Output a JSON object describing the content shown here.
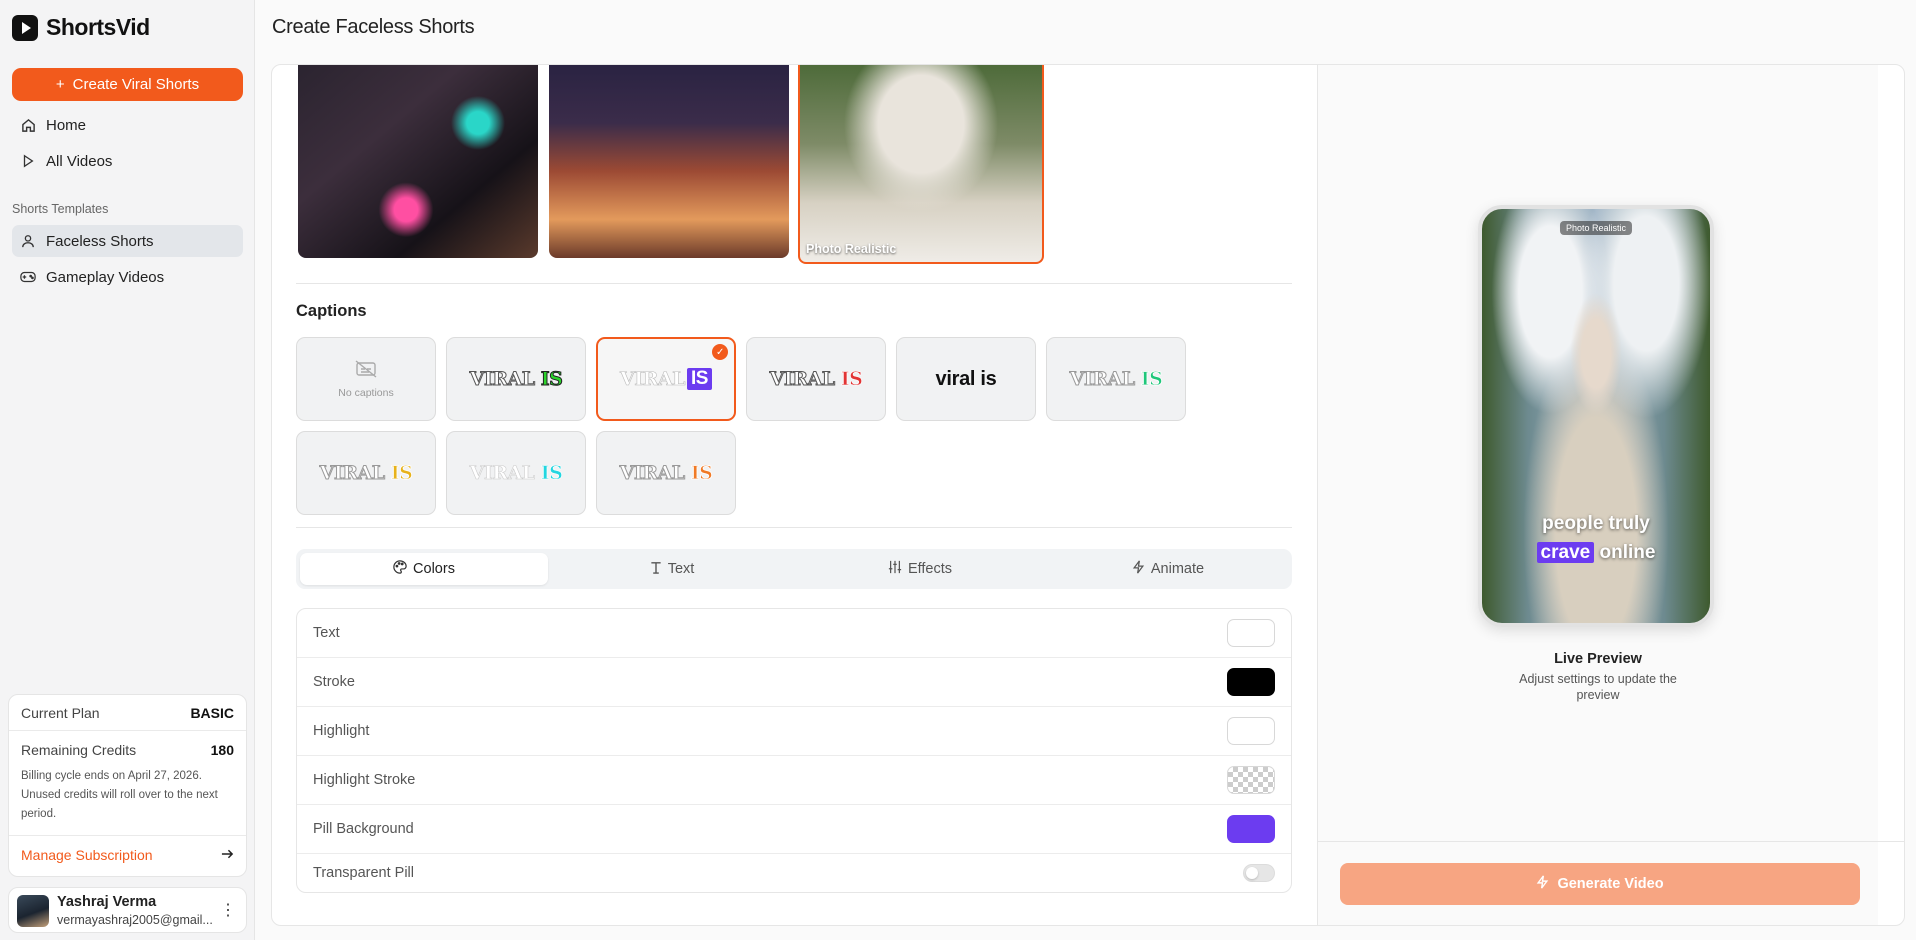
{
  "app": {
    "name": "ShortsVid"
  },
  "sidebar": {
    "create_label": "Create Viral Shorts",
    "nav": [
      {
        "label": "Home"
      },
      {
        "label": "All Videos"
      }
    ],
    "templates_label": "Shorts Templates",
    "templates": [
      {
        "label": "Faceless Shorts",
        "active": true
      },
      {
        "label": "Gameplay Videos",
        "active": false
      }
    ]
  },
  "plan": {
    "current_label": "Current Plan",
    "current_value": "BASIC",
    "credits_label": "Remaining Credits",
    "credits_value": "180",
    "billing_note": "Billing cycle ends on April 27, 2026. Unused credits will roll over to the next period.",
    "manage_label": "Manage Subscription"
  },
  "user": {
    "name": "Yashraj Verma",
    "email": "vermayashraj2005@gmail..."
  },
  "header": {
    "title": "Create Faceless Shorts"
  },
  "styles": {
    "selected_label": "Photo Realistic"
  },
  "captions": {
    "title": "Captions",
    "none_label": "No captions",
    "sample_word1": "VIRAL",
    "sample_word2": "IS",
    "sample_lower": "viral is"
  },
  "tabs": [
    {
      "label": "Colors",
      "icon": "palette-icon",
      "active": true
    },
    {
      "label": "Text",
      "icon": "text-icon",
      "active": false
    },
    {
      "label": "Effects",
      "icon": "sliders-icon",
      "active": false
    },
    {
      "label": "Animate",
      "icon": "lightning-icon",
      "active": false
    }
  ],
  "settings": [
    {
      "label": "Text",
      "color": "#ffffff"
    },
    {
      "label": "Stroke",
      "color": "#000000"
    },
    {
      "label": "Highlight",
      "color": "#ffffff"
    },
    {
      "label": "Highlight Stroke",
      "color": "transparent"
    },
    {
      "label": "Pill Background",
      "color": "#6c3cf0"
    },
    {
      "label": "Transparent Pill",
      "toggle": false
    }
  ],
  "preview": {
    "tag": "Photo Realistic",
    "caption_line1": "people truly",
    "caption_word_highlight": "crave",
    "caption_word_after": "online",
    "title": "Live Preview",
    "subtitle": "Adjust settings to update the preview",
    "generate_label": "Generate Video"
  },
  "colors": {
    "accent": "#f25a1c",
    "pill": "#6c3cf0",
    "generate_disabled": "#f7a582"
  }
}
